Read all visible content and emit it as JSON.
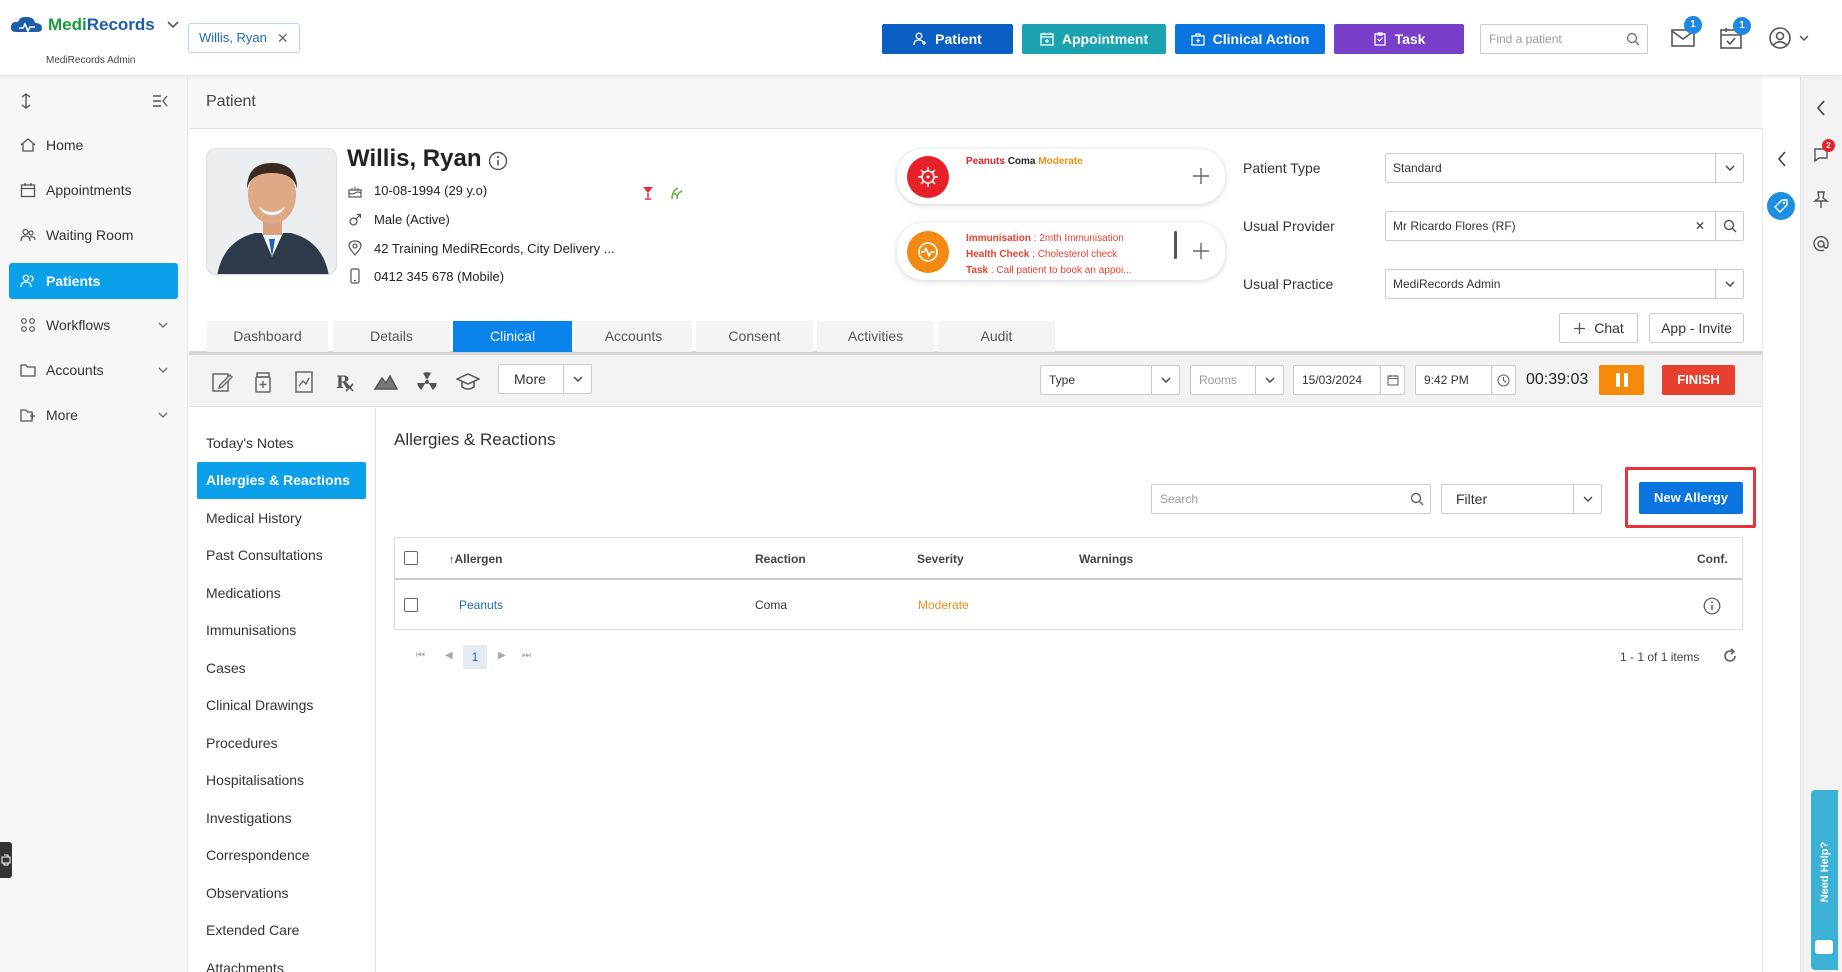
{
  "topbar": {
    "logo_main": "Medi",
    "logo_accent": "Records",
    "logo_sub": "MediRecords Admin",
    "patient_chip": "Willis, Ryan",
    "buttons": [
      {
        "label": "Patient",
        "color": "#0b5fc4"
      },
      {
        "label": "Appointment",
        "color": "#1ba3b0"
      },
      {
        "label": "Clinical Action",
        "color": "#0a74e0"
      },
      {
        "label": "Task",
        "color": "#7a3fc9"
      }
    ],
    "search_placeholder": "Find a patient",
    "mail_badge": "1",
    "tasks_badge": "1"
  },
  "sidebar": {
    "items": [
      {
        "label": "Home",
        "icon": "home-icon"
      },
      {
        "label": "Appointments",
        "icon": "calendar-icon"
      },
      {
        "label": "Waiting Room",
        "icon": "users-icon"
      },
      {
        "label": "Patients",
        "icon": "patients-icon",
        "active": true
      },
      {
        "label": "Workflows",
        "icon": "workflow-icon",
        "expandable": true
      },
      {
        "label": "Accounts",
        "icon": "folder-icon",
        "expandable": true
      },
      {
        "label": "More",
        "icon": "folder-tree-icon",
        "expandable": true
      }
    ]
  },
  "page": {
    "title": "Patient"
  },
  "patient": {
    "name": "Willis, Ryan",
    "dob": "10-08-1994 (29 y.o)",
    "gender": "Male (Active)",
    "address": "42 Training MediREcords, City Delivery ...",
    "phone": "0412 345 678 (Mobile)"
  },
  "alerts": {
    "allergy": {
      "allergen": "Peanuts",
      "reaction": "Coma",
      "severity": "Moderate"
    },
    "clinical": [
      {
        "label": "Immunisation",
        "text": "2mth Immunisation"
      },
      {
        "label": "Health Check",
        "text": "Cholesterol check"
      },
      {
        "label": "Task",
        "text": "Call patient to book an appoi..."
      }
    ]
  },
  "patient_form": {
    "type_label": "Patient Type",
    "type_value": "Standard",
    "provider_label": "Usual Provider",
    "provider_value": "Mr Ricardo Flores (RF)",
    "practice_label": "Usual Practice",
    "practice_value": "MediRecords Admin",
    "chat_label": "Chat",
    "invite_label": "App - Invite"
  },
  "tabs": [
    "Dashboard",
    "Details",
    "Clinical",
    "Accounts",
    "Consent",
    "Activities",
    "Audit"
  ],
  "active_tab": "Clinical",
  "toolbar": {
    "more_label": "More",
    "type_placeholder": "Type",
    "rooms_placeholder": "Rooms",
    "date": "15/03/2024",
    "time": "9:42 PM",
    "timer": "00:39:03",
    "finish_label": "FINISH"
  },
  "clinical_nav": [
    "Today's Notes",
    "Allergies & Reactions",
    "Medical History",
    "Past Consultations",
    "Medications",
    "Immunisations",
    "Cases",
    "Clinical Drawings",
    "Procedures",
    "Hospitalisations",
    "Investigations",
    "Correspondence",
    "Observations",
    "Extended Care",
    "Attachments"
  ],
  "clinical_nav_active": "Allergies & Reactions",
  "allergies": {
    "title": "Allergies & Reactions",
    "search_placeholder": "Search",
    "filter_placeholder": "Filter",
    "new_button": "New Allergy",
    "columns": {
      "allergen": "Allergen",
      "reaction": "Reaction",
      "severity": "Severity",
      "warnings": "Warnings",
      "conf": "Conf."
    },
    "rows": [
      {
        "allergen": "Peanuts",
        "reaction": "Coma",
        "severity": "Moderate",
        "warnings": ""
      }
    ],
    "page": "1",
    "pager_text": "1 - 1 of 1 items"
  },
  "rightrail": {
    "notifications_badge": "2",
    "help_label": "Need Help?"
  },
  "colors": {
    "accent": "#0aa0ea",
    "severity": "#f0901a",
    "danger": "#e8402e",
    "link": "#1e6bb8"
  }
}
